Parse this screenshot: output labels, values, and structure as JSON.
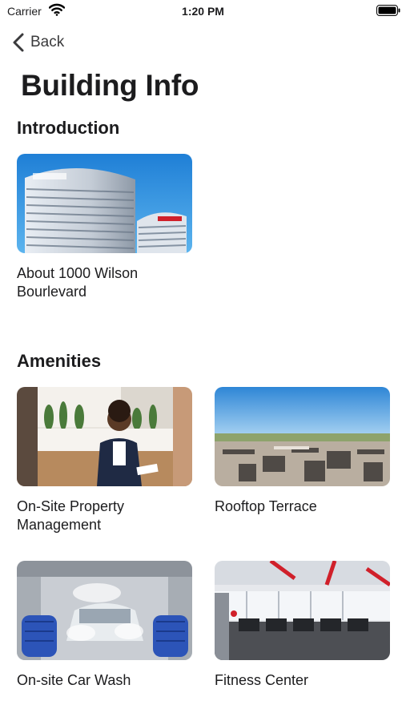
{
  "status_bar": {
    "carrier": "Carrier",
    "time": "1:20 PM"
  },
  "nav": {
    "back_label": "Back"
  },
  "page": {
    "title": "Building Info"
  },
  "sections": {
    "introduction": {
      "title": "Introduction",
      "cards": [
        {
          "caption": "About 1000 Wilson Bourlevard"
        }
      ]
    },
    "amenities": {
      "title": "Amenities",
      "cards": [
        {
          "caption": "On-Site Property Management"
        },
        {
          "caption": "Rooftop Terrace"
        },
        {
          "caption": "On-site Car Wash"
        },
        {
          "caption": "Fitness Center"
        }
      ]
    }
  },
  "icons": {
    "back": "chevron-left-icon",
    "wifi": "wifi-icon",
    "battery": "battery-icon"
  },
  "colors": {
    "text": "#1c1c1e",
    "background": "#ffffff",
    "sky": "#2e86d6"
  }
}
